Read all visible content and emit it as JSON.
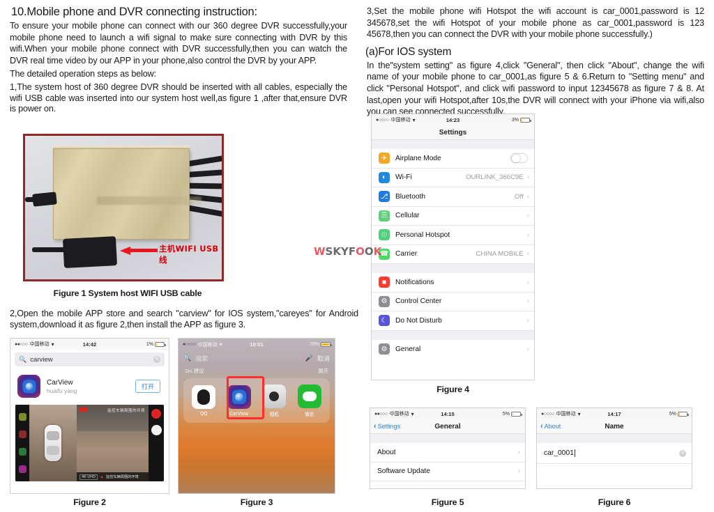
{
  "left": {
    "heading": "10.Mobile phone and DVR connecting instruction:",
    "intro": "          To ensure your mobile phone can connect with our 360 degree DVR successfully,your mobile phone need to launch a wifi signal to make sure connecting with DVR by this wifi.When your mobile phone connect with DVR successfully,then you can watch the DVR real time video by our APP in your phone,also control the DVR by your APP.",
    "steps_lead": "The detailed operation steps as below:",
    "step1": "1,The system host of 360 degree DVR should be inserted with all cables, especially the wifi USB cable was inserted into our system host well,as figure 1 ,after that,ensure DVR is power on.",
    "step2": "2,Open the mobile APP store and search \"carview\" for IOS system,\"careyes\" for Android system,download it as figure 2,then install the APP as figure 3."
  },
  "right": {
    "step3": "3,Set the mobile phone wifi Hotspot the wifi account is car_0001,password is 12 345678,set the wifi Hotspot of your mobile phone as car_0001,password is 123 45678,then you can connect the DVR with your mobile phone successfully.)",
    "heading_ios": "(a)For IOS system",
    "ios_body": "In the\"system setting\" as figure 4,click \"General\", then click \"About\", change the wifi name of your mobile phone to car_0001,as figure 5 & 6.Return to \"Setting menu\" and click \"Personal Hotspot\", and click wifi password to input 12345678 as figure 7 & 8. At last,open your wifi Hotspot,after 10s,the DVR will connect with your iPhone via wifi,also you can see connected successfully."
  },
  "watermark": {
    "part_red_1": "W",
    "part_dark_1": "SKYF",
    "part_red_2": "O",
    "part_dark_2": "O",
    "part_red_3": "K"
  },
  "figure1": {
    "caption": "Figure 1 System host WIFI USB cable",
    "annotation": "主机WIFI USB线",
    "border_color": "#8c2a2a",
    "arrow_color": "#e8141e"
  },
  "figure2": {
    "caption": "Figure 2",
    "status": {
      "dots": "●●○○○",
      "carrier": "中国移动",
      "wifi": "wifi-icon",
      "time": "14:42",
      "battery_pct": "1%"
    },
    "search_value": "carview",
    "search_icon": "search-icon",
    "clear_icon": "clear-icon",
    "app": {
      "name": "CarView",
      "developer": "huaifu yang",
      "open_label": "打开"
    },
    "preview": {
      "badge1": "4K UHD",
      "badge2": "监控车辆周围的环境"
    }
  },
  "figure3": {
    "caption": "Figure 3",
    "status": {
      "dots": "●○○○○",
      "carrier": "中国移动",
      "time": "18:01",
      "battery_pct": "78%"
    },
    "search_placeholder": "搜索",
    "cancel_label": "取消",
    "siri_label": "Siri 建议",
    "more_label": "展开",
    "apps": [
      {
        "name": "QQ",
        "icon": "qq-icon"
      },
      {
        "name": "CarView",
        "icon": "carview-icon"
      },
      {
        "name": "相机",
        "icon": "camera-icon"
      },
      {
        "name": "微信",
        "icon": "wechat-icon"
      }
    ],
    "highlighted_app": "CarView"
  },
  "figure4": {
    "caption": "Figure 4",
    "status": {
      "dots": "●○○○○",
      "carrier": "中国移动",
      "time": "14:23",
      "battery_pct": "3%"
    },
    "title": "Settings",
    "groups": [
      {
        "rows": [
          {
            "label": "Airplane Mode",
            "value": "",
            "icon": "airplane-icon",
            "icon_color": "#f5a623",
            "control": "toggle-off"
          },
          {
            "label": "Wi-Fi",
            "value": "OURLINK_366C9E",
            "icon": "wifi-icon",
            "icon_color": "#1e88e5",
            "control": "chevron"
          },
          {
            "label": "Bluetooth",
            "value": "Off",
            "icon": "bluetooth-icon",
            "icon_color": "#1e7ae0",
            "control": "chevron"
          },
          {
            "label": "Cellular",
            "value": "",
            "icon": "cellular-icon",
            "icon_color": "#5ed07a",
            "control": "chevron"
          },
          {
            "label": "Personal Hotspot",
            "value": "",
            "icon": "hotspot-icon",
            "icon_color": "#4cd07a",
            "control": "chevron"
          },
          {
            "label": "Carrier",
            "value": "CHINA MOBILE",
            "icon": "phone-icon",
            "icon_color": "#4cd964",
            "control": "chevron"
          }
        ]
      },
      {
        "rows": [
          {
            "label": "Notifications",
            "value": "",
            "icon": "notifications-icon",
            "icon_color": "#ff3b30",
            "control": "chevron"
          },
          {
            "label": "Control Center",
            "value": "",
            "icon": "control-center-icon",
            "icon_color": "#8e8e93",
            "control": "chevron"
          },
          {
            "label": "Do Not Disturb",
            "value": "",
            "icon": "moon-icon",
            "icon_color": "#5856d6",
            "control": "chevron"
          }
        ]
      },
      {
        "rows": [
          {
            "label": "General",
            "value": "",
            "icon": "gear-icon",
            "icon_color": "#8e8e93",
            "control": "chevron"
          }
        ]
      }
    ]
  },
  "figure5": {
    "caption": "Figure 5",
    "status": {
      "dots": "●●○○○",
      "carrier": "中国移动",
      "time": "14:15",
      "battery_pct": "5%"
    },
    "back_label": "Settings",
    "title": "General",
    "rows": [
      {
        "label": "About"
      },
      {
        "label": "Software Update"
      }
    ]
  },
  "figure6": {
    "caption": "Figure 6",
    "status": {
      "dots": "●○○○○",
      "carrier": "中国移动",
      "time": "14:17",
      "battery_pct": "5%"
    },
    "back_label": "About",
    "title": "Name",
    "name_value": "car_0001",
    "clear_icon": "clear-icon"
  }
}
